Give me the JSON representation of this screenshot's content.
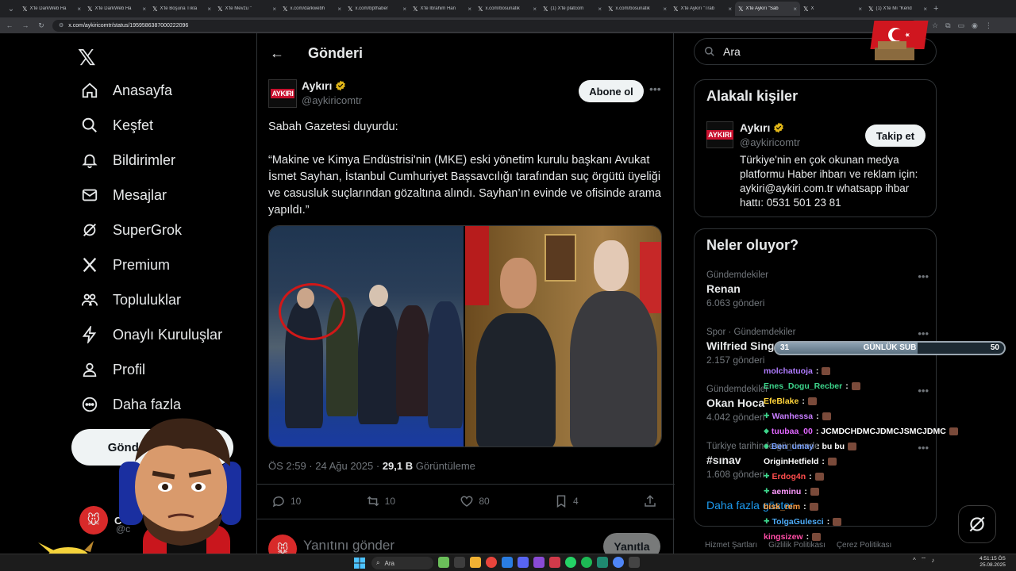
{
  "browser": {
    "tabs": [
      {
        "title": "X'te DarkWeb Ha"
      },
      {
        "title": "X'te DarkWeb Ha"
      },
      {
        "title": "X'te Boşuna Tıkla"
      },
      {
        "title": "X'te Mevzu \""
      },
      {
        "title": "x.com/darkwebh"
      },
      {
        "title": "x.com/bpthaber"
      },
      {
        "title": "X'te İbrahim Han"
      },
      {
        "title": "x.com/bosunatik"
      },
      {
        "title": "(1) X'te platcom"
      },
      {
        "title": "x.com/bosunatik"
      },
      {
        "title": "X'te Aykırı \"Trab"
      },
      {
        "title": "X'te Aykırı \"Sab",
        "active": true
      },
      {
        "title": "X"
      },
      {
        "title": "(1) X'te Mı \"Kend"
      }
    ],
    "url": "x.com/aykiricomtr/status/1959586387000222096"
  },
  "nav": {
    "items": [
      {
        "label": "Anasayfa",
        "icon": "home-icon"
      },
      {
        "label": "Keşfet",
        "icon": "search-icon"
      },
      {
        "label": "Bildirimler",
        "icon": "bell-icon"
      },
      {
        "label": "Mesajlar",
        "icon": "mail-icon"
      },
      {
        "label": "SuperGrok",
        "icon": "grok-icon"
      },
      {
        "label": "Premium",
        "icon": "x-premium-icon"
      },
      {
        "label": "Topluluklar",
        "icon": "communities-icon"
      },
      {
        "label": "Onaylı Kuruluşlar",
        "icon": "lightning-icon"
      },
      {
        "label": "Profil",
        "icon": "person-icon"
      },
      {
        "label": "Daha fazla",
        "icon": "more-circle-icon"
      }
    ],
    "post_button": "Gönderi yayınla",
    "account_name": "C",
    "account_handle": "@c"
  },
  "main": {
    "title": "Gönderi",
    "post": {
      "author_name": "Aykırı",
      "author_handle": "@aykiricomtr",
      "avatar_text": "AYKIRI",
      "follow_label": "Abone ol",
      "text": "Sabah Gazetesi duyurdu:\n\n“Makine ve Kimya Endüstrisi'nin (MKE) eski yönetim kurulu başkanı Avukat İsmet Sayhan, İstanbul Cumhuriyet Başsavcılığı tarafından suç örgütü üyeliği ve casusluk suçlarından gözaltına alındı. Sayhan’ın evinde ve ofisinde arama yapıldı.”",
      "time": "ÖS 2:59 · 24 Ağu 2025 · ",
      "views": "29,1 B",
      "views_label": " Görüntüleme",
      "replies": "10",
      "reposts": "10",
      "likes": "80",
      "bookmarks": "4"
    },
    "reply": {
      "placeholder": "Yanıtını gönder",
      "button": "Yanıtla"
    }
  },
  "right": {
    "search_placeholder": "Ara",
    "related": {
      "title": "Alakalı kişiler",
      "name": "Aykırı",
      "handle": "@aykiricomtr",
      "avatar_text": "AYKIRI",
      "follow_label": "Takip et",
      "bio": "Türkiye'nin en çok okunan medya platformu Haber ihbarı ve reklam için: aykiri@aykiri.com.tr whatsapp ihbar hattı: 0531 501 23 81"
    },
    "trends_title": "Neler oluyor?",
    "trends": [
      {
        "category": "Gündemdekiler",
        "name": "Renan",
        "count": "6.063 gönderi"
      },
      {
        "category": "Spor · Gündemdekiler",
        "name": "Wilfried Singo",
        "count": "2.157 gönderi"
      },
      {
        "category": "Gündemdekiler",
        "name": "Okan Hoca",
        "count": "4.042 gönderi"
      },
      {
        "category": "Türkiye tarihinde gündemde",
        "name": "#sınav",
        "count": "1.608 gönderi"
      }
    ],
    "show_more": "Daha fazla göster",
    "footer": [
      "Hizmet Şartları",
      "Gizlilik Politikası",
      "Çerez Politikası"
    ]
  },
  "overlay": {
    "sub_goal": {
      "current": "31",
      "label": "GÜNLÜK SUB",
      "target": "50",
      "progress": 0.62
    },
    "chat": [
      {
        "user": "molchatuoja",
        "color": "#b07cff",
        "badge": "",
        "msg": ":"
      },
      {
        "user": "Enes_Dogu_Recber",
        "color": "#3dd68c",
        "badge": "",
        "msg": ":"
      },
      {
        "user": "EfeBlake",
        "color": "#ffd43b",
        "badge": "",
        "msg": ":"
      },
      {
        "user": "Wanhessa",
        "color": "#c77dff",
        "badge": "✚",
        "msg": ":"
      },
      {
        "user": "tuubaa_00",
        "color": "#e066ff",
        "badge": "◆",
        "msg": ": JCMDCHDMCJDMCJSMCJDMC"
      },
      {
        "user": "Ben_umay",
        "color": "#7aa2ff",
        "badge": "◆",
        "msg": ": bu bu"
      },
      {
        "user": "OriginHetfield",
        "color": "#ffffff",
        "badge": "",
        "msg": ":"
      },
      {
        "user": "Erdog4n",
        "color": "#ff4d4d",
        "badge": "✚",
        "msg": ":"
      },
      {
        "user": "aeminu",
        "color": "#ff9aff",
        "badge": "✚",
        "msg": ":"
      },
      {
        "user": "bisk_rem",
        "color": "#ff9f43",
        "badge": "",
        "msg": ":"
      },
      {
        "user": "TolgaGulesci",
        "color": "#4dabf7",
        "badge": "✚",
        "msg": ":"
      },
      {
        "user": "kingsizew",
        "color": "#ff4da6",
        "badge": "",
        "msg": ":"
      }
    ]
  },
  "taskbar": {
    "search": "Ara",
    "time": "4:51:15 ÖS",
    "date": "25.08.2025"
  }
}
